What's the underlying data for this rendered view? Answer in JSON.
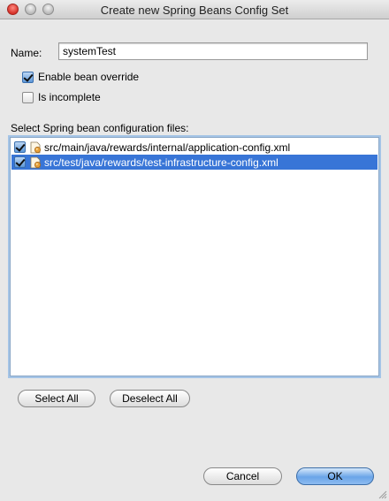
{
  "window": {
    "title": "Create new Spring Beans Config Set"
  },
  "form": {
    "name_label": "Name:",
    "name_value": "systemTest",
    "enable_override": {
      "label": "Enable bean override",
      "checked": true
    },
    "incomplete": {
      "label": "Is incomplete",
      "checked": false
    }
  },
  "files": {
    "section_label": "Select Spring bean configuration files:",
    "items": [
      {
        "path": "src/main/java/rewards/internal/application-config.xml",
        "checked": true,
        "selected": false
      },
      {
        "path": "src/test/java/rewards/test-infrastructure-config.xml",
        "checked": true,
        "selected": true
      }
    ]
  },
  "actions": {
    "select_all": "Select All",
    "deselect_all": "Deselect All",
    "cancel": "Cancel",
    "ok": "OK"
  },
  "colors": {
    "selection": "#3875d7",
    "default_button": "#6aa4e8",
    "window_bg": "#e8e8e8"
  },
  "icons": {
    "file_icon": "spring-beans-xml-icon"
  }
}
